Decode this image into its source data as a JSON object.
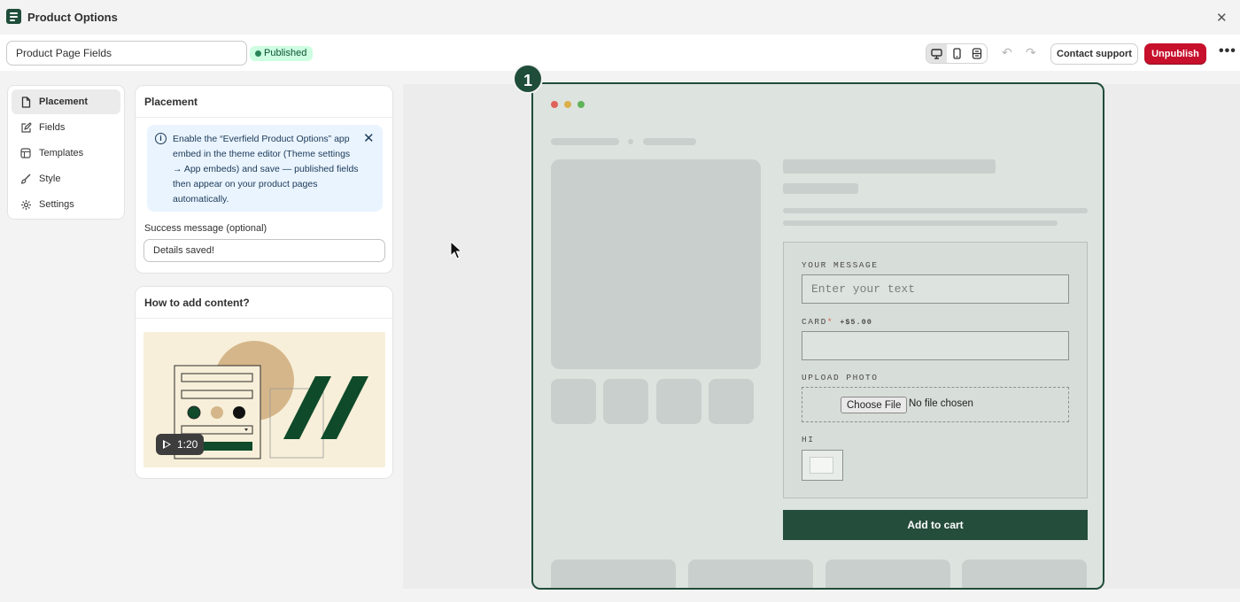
{
  "window": {
    "title": "Product Options",
    "close_icon": "close-icon"
  },
  "toolbar": {
    "name_value": "Product Page Fields",
    "status_badge": "Published",
    "view_modes": [
      "desktop-icon",
      "mobile-icon",
      "fullscreen-icon"
    ],
    "undo_icon": "undo-icon",
    "redo_icon": "redo-icon",
    "support_label": "Contact support",
    "unpublish_label": "Unpublish",
    "more_icon": "more-horizontal-icon"
  },
  "sidebar": {
    "items": [
      {
        "label": "Placement",
        "icon": "page-icon",
        "active": true
      },
      {
        "label": "Fields",
        "icon": "edit-icon",
        "active": false
      },
      {
        "label": "Templates",
        "icon": "template-icon",
        "active": false
      },
      {
        "label": "Style",
        "icon": "brush-icon",
        "active": false
      },
      {
        "label": "Settings",
        "icon": "gear-icon",
        "active": false
      }
    ]
  },
  "placement_panel": {
    "title": "Placement",
    "banner_text": "Enable the “Everfield Product Options” app embed in the theme editor (Theme settings → App embeds) and save — published fields then appear on your product pages automatically.",
    "success_label": "Success message (optional)",
    "success_value": "Details saved!"
  },
  "help_panel": {
    "title": "How to add content?",
    "video_duration": "1:20"
  },
  "preview": {
    "step_number": "1",
    "fields": {
      "message_label": "YOUR MESSAGE",
      "message_placeholder": "Enter your text",
      "card_label": "CARD",
      "card_required": "*",
      "card_price": "+$5.00",
      "upload_label": "UPLOAD PHOTO",
      "choose_file": "Choose File",
      "no_file": "No file chosen",
      "hi_label": "HI"
    },
    "add_to_cart": "Add to cart"
  },
  "colors": {
    "brand": "#1f4d3a",
    "danger": "#c7102c",
    "success_bg": "#cdfee1",
    "info_bg": "#eaf4ff"
  }
}
